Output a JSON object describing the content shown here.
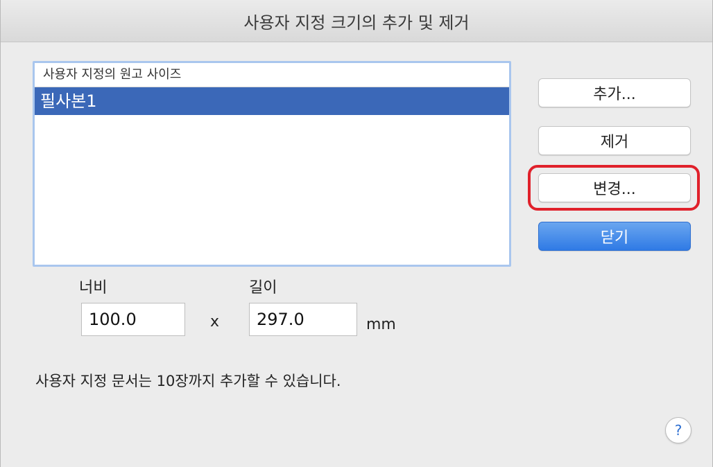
{
  "window": {
    "title": "사용자 지정 크기의 추가 및 제거"
  },
  "list": {
    "header": "사용자 지정의 원고 사이즈",
    "items": [
      "필사본1"
    ],
    "selected_index": 0
  },
  "buttons": {
    "add": "추가...",
    "remove": "제거",
    "change": "변경...",
    "close": "닫기"
  },
  "dimensions": {
    "width_label": "너비",
    "length_label": "길이",
    "width_value": "100.0",
    "length_value": "297.0",
    "separator": "x",
    "unit": "mm"
  },
  "info_text": "사용자 지정 문서는 10장까지 추가할 수 있습니다.",
  "help": {
    "label": "?",
    "icon": "help-icon"
  },
  "colors": {
    "selection": "#3b68b8",
    "primary_button": "#2f7ae5",
    "highlight_border": "#e0212b",
    "list_focus_ring": "#a9c6ee"
  }
}
